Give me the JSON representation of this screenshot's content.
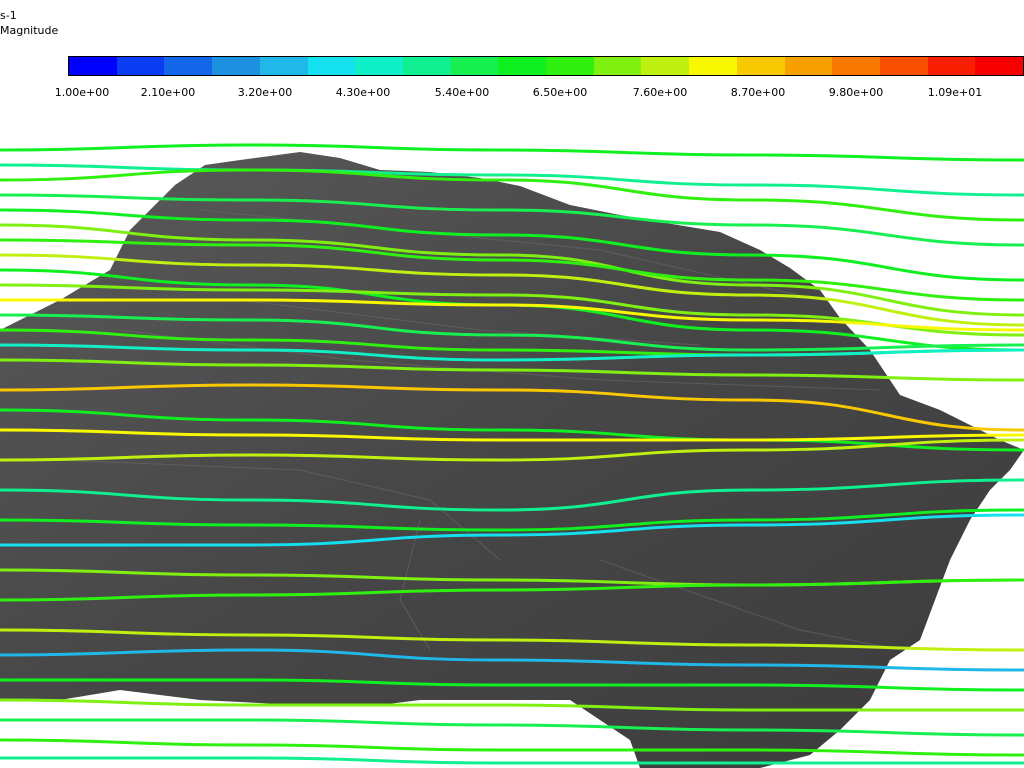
{
  "legend": {
    "title_line1": "s-1",
    "title_line2": "Magnitude",
    "colors": [
      "#0000ff",
      "#0a3cf4",
      "#1466e8",
      "#1e90e0",
      "#20b8e8",
      "#14e0f0",
      "#10f0c8",
      "#10f090",
      "#18f050",
      "#10f020",
      "#30f010",
      "#80f010",
      "#c0f010",
      "#f8f800",
      "#f8c800",
      "#f8a000",
      "#f87800",
      "#f85000",
      "#f82000",
      "#f80000"
    ],
    "ticks": [
      "1.00e+00",
      "2.10e+00",
      "3.20e+00",
      "4.30e+00",
      "5.40e+00",
      "6.50e+00",
      "7.60e+00",
      "8.70e+00",
      "9.80e+00",
      "1.09e+01"
    ]
  },
  "scene": {
    "terrain_color": "#4e4e4e",
    "description_icon": "terrain-surface"
  }
}
